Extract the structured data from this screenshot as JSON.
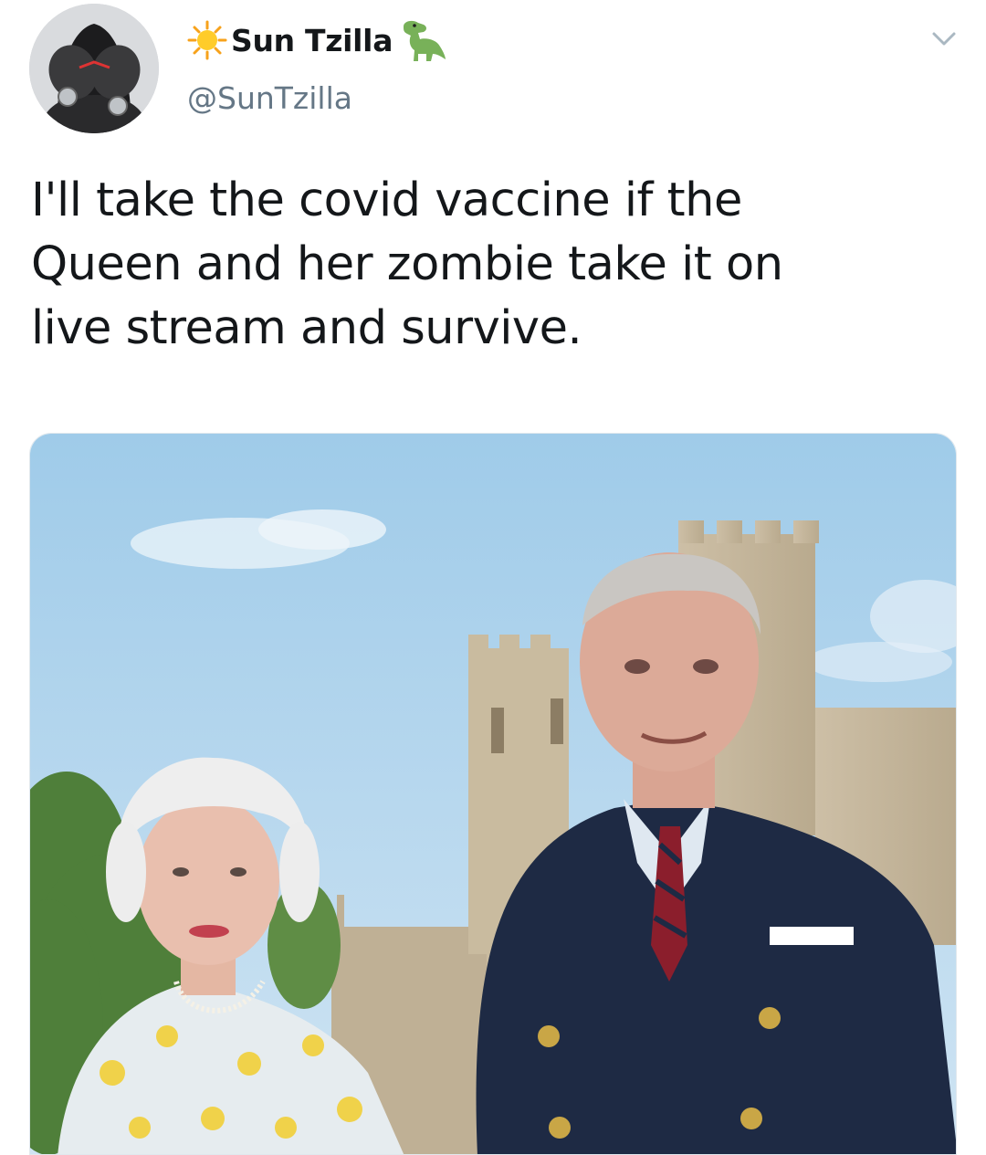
{
  "tweet": {
    "author": {
      "display_name": "Sun Tzilla",
      "name_prefix_emoji": "☀️",
      "name_suffix_emoji": "🦖",
      "handle": "@SunTzilla",
      "avatar_icon": "hooded-figure-avatar"
    },
    "menu_icon": "chevron-down-icon",
    "text_lines": [
      "I'll take the covid vaccine if the",
      "Queen and her zombie take it on",
      "live stream and survive."
    ],
    "media": {
      "kind": "photo"
    }
  },
  "colors": {
    "text_primary": "#14171a",
    "text_secondary": "#657786",
    "chevron": "#aab8c2",
    "sky": "#a9cfe9"
  }
}
